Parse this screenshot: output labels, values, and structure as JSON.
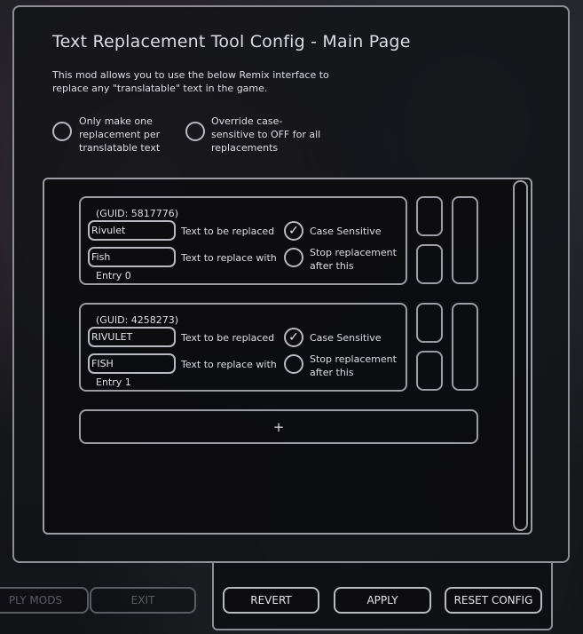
{
  "title": "Text Replacement Tool Config - Main Page",
  "description": "This mod allows you to use the below Remix interface to replace any \"translatable\" text in the game.",
  "options": [
    {
      "label": "Only make one replacement per translatable text",
      "checked": false
    },
    {
      "label": "Override case-sensitive to OFF for all replacements",
      "checked": false
    }
  ],
  "entries": [
    {
      "guid": "(GUID: 5817776)",
      "text_to_replace": "Rivulet",
      "replace_with": "Fish",
      "label_replaced": "Text to be replaced",
      "label_with": "Text to replace with",
      "case_sensitive_label": "Case Sensitive",
      "case_sensitive": true,
      "stop_label": "Stop replacement after this",
      "stop": false,
      "entry_label": "Entry 0"
    },
    {
      "guid": "(GUID: 4258273)",
      "text_to_replace": "RIVULET",
      "replace_with": "FISH",
      "label_replaced": "Text to be replaced",
      "label_with": "Text to replace with",
      "case_sensitive_label": "Case Sensitive",
      "case_sensitive": true,
      "stop_label": "Stop replacement after this",
      "stop": false,
      "entry_label": "Entry 1"
    }
  ],
  "add_label": "+",
  "checkmark": "✓",
  "buttons": {
    "apply_mods": "PLY MODS",
    "exit": "EXIT",
    "revert": "REVERT",
    "apply": "APPLY",
    "reset_config": "RESET CONFIG"
  }
}
